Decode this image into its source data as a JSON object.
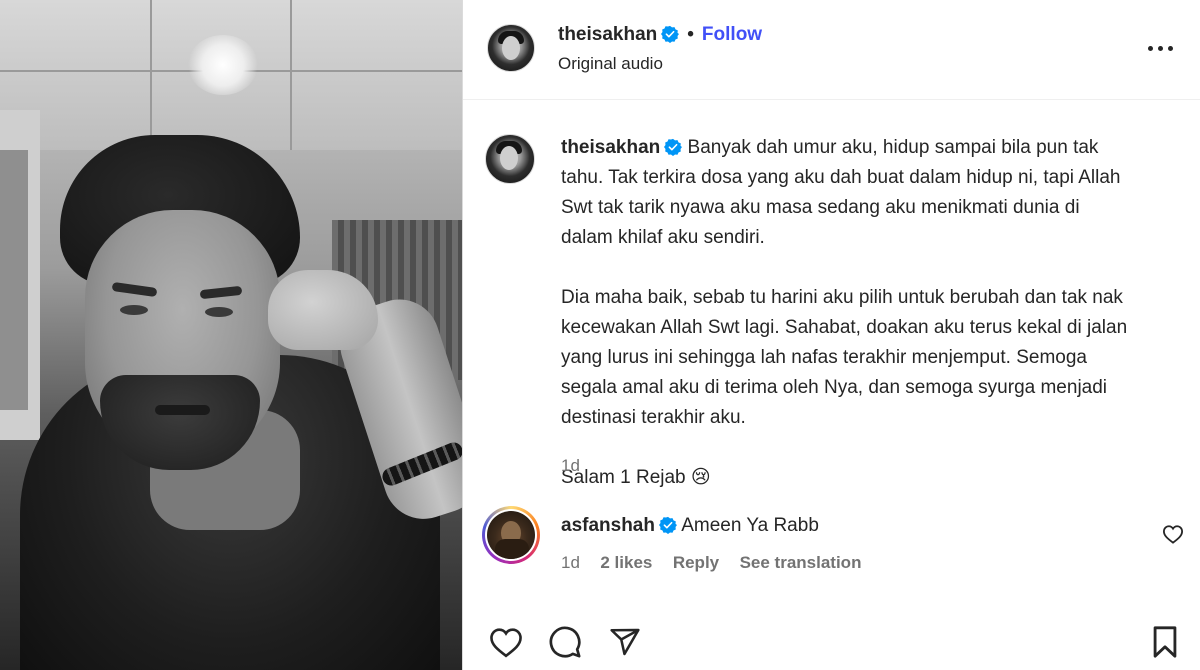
{
  "post_header": {
    "username": "theisakhan",
    "separator": "•",
    "follow_label": "Follow",
    "audio_label": "Original audio"
  },
  "caption": {
    "username": "theisakhan",
    "lines": [
      "Banyak dah umur aku, hidup sampai bila pun tak",
      "tahu. Tak terkira dosa yang aku dah buat dalam hidup ni, tapi Allah",
      "Swt tak tarik nyawa aku masa sedang aku menikmati dunia di",
      "dalam khilaf aku sendiri.",
      "Dia maha baik, sebab tu harini aku pilih untuk berubah dan tak nak",
      "kecewakan Allah Swt lagi. Sahabat, doakan aku terus kekal di jalan",
      "yang lurus ini sehingga lah nafas terakhir menjemput. Semoga",
      "segala amal aku di terima oleh Nya, dan semoga syurga menjadi",
      "destinasi terakhir aku.",
      "Salam 1 Rejab"
    ],
    "emoji": "😢",
    "time": "1d"
  },
  "comment": {
    "username": "asfanshah",
    "text": "Ameen Ya Rabb",
    "time": "1d",
    "likes": "2 likes",
    "reply_label": "Reply",
    "translate_label": "See translation"
  },
  "icons": {
    "more": "more-options-icon",
    "verified": "verified-badge-icon",
    "heart": "heart-icon",
    "comment": "comment-icon",
    "share": "share-icon",
    "save": "bookmark-icon",
    "comment_like": "small-heart-icon"
  },
  "colors": {
    "follow_blue": "#4150f7",
    "verified_blue": "#0095f6",
    "text": "#262626",
    "muted": "#737373"
  }
}
